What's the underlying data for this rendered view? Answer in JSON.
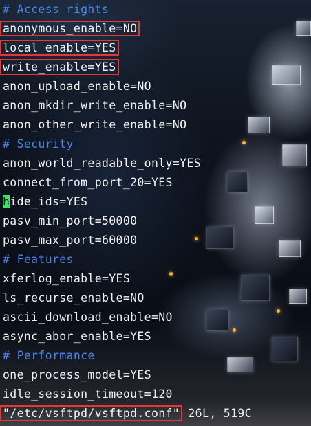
{
  "editor": {
    "lines": [
      {
        "text": "# Access rights",
        "kind": "comment"
      },
      {
        "text": "anonymous_enable=NO",
        "kind": "setting",
        "highlighted": true
      },
      {
        "text": "local_enable=YES",
        "kind": "setting",
        "highlighted": true
      },
      {
        "text": "write_enable=YES",
        "kind": "setting",
        "highlighted": true
      },
      {
        "text": "anon_upload_enable=NO",
        "kind": "setting"
      },
      {
        "text": "anon_mkdir_write_enable=NO",
        "kind": "setting"
      },
      {
        "text": "anon_other_write_enable=NO",
        "kind": "setting"
      },
      {
        "text": "# Security",
        "kind": "comment"
      },
      {
        "text": "anon_world_readable_only=YES",
        "kind": "setting"
      },
      {
        "text": "connect_from_port_20=YES",
        "kind": "setting"
      },
      {
        "text": "hide_ids=YES",
        "kind": "setting",
        "cursor": true
      },
      {
        "text": "pasv_min_port=50000",
        "kind": "setting"
      },
      {
        "text": "pasv_max_port=60000",
        "kind": "setting"
      },
      {
        "text": "# Features",
        "kind": "comment"
      },
      {
        "text": "xferlog_enable=YES",
        "kind": "setting"
      },
      {
        "text": "ls_recurse_enable=NO",
        "kind": "setting"
      },
      {
        "text": "ascii_download_enable=NO",
        "kind": "setting"
      },
      {
        "text": "async_abor_enable=YES",
        "kind": "setting"
      },
      {
        "text": "# Performance",
        "kind": "comment"
      },
      {
        "text": "one_process_model=YES",
        "kind": "setting"
      },
      {
        "text": "idle_session_timeout=120",
        "kind": "setting"
      }
    ],
    "status": {
      "filename": "\"/etc/vsftpd/vsftpd.conf\"",
      "info": " 26L, 519C"
    }
  },
  "colors": {
    "comment": "#4a86e8",
    "text": "#f2f2f2",
    "highlight_box": "#e33838",
    "cursor": "#3fe36f"
  }
}
